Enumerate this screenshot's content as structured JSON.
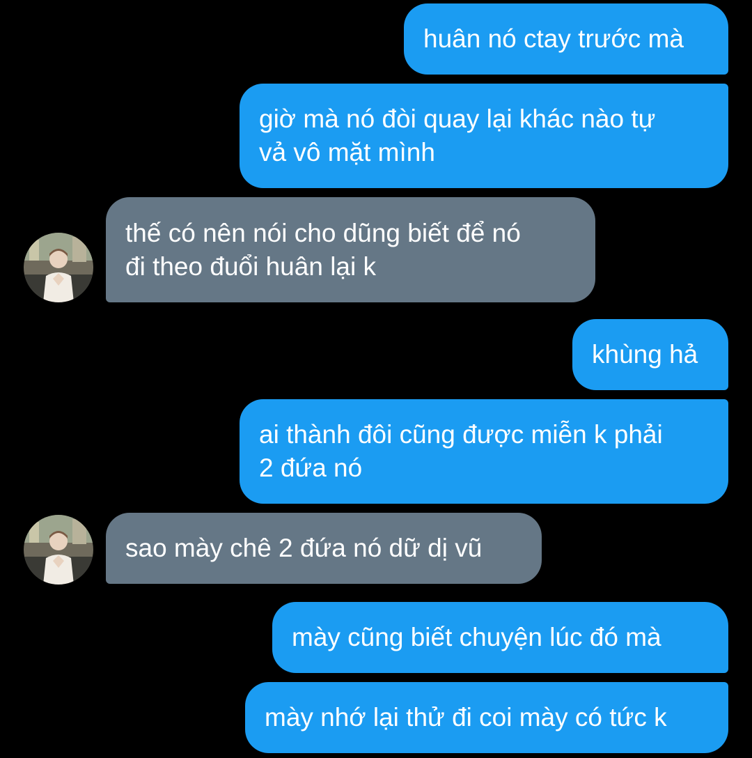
{
  "messages": [
    {
      "side": "sent",
      "lines": [
        "huân nó ctay trước mà"
      ]
    },
    {
      "side": "sent",
      "lines": [
        "giờ mà nó đòi quay lại khác nào tự",
        "vả vô mặt mình"
      ]
    },
    {
      "side": "received",
      "lines": [
        "thế có nên nói cho dũng biết để nó",
        "đi theo đuổi huân lại k"
      ],
      "avatar": "user-avatar"
    },
    {
      "side": "sent",
      "lines": [
        "khùng hả"
      ]
    },
    {
      "side": "sent",
      "lines": [
        "ai thành đôi cũng được miễn k phải",
        "2 đứa nó"
      ]
    },
    {
      "side": "received",
      "lines": [
        "sao mày chê 2 đứa nó dữ dị vũ"
      ],
      "avatar": "user-avatar"
    },
    {
      "side": "sent",
      "lines": [
        "mày cũng biết chuyện lúc đó mà"
      ]
    },
    {
      "side": "sent",
      "lines": [
        "mày nhớ lại thử đi coi mày có tức k"
      ]
    }
  ],
  "colors": {
    "background": "#000000",
    "sent_bubble": "#1b9cf2",
    "received_bubble": "#657786",
    "text": "#ffffff"
  }
}
